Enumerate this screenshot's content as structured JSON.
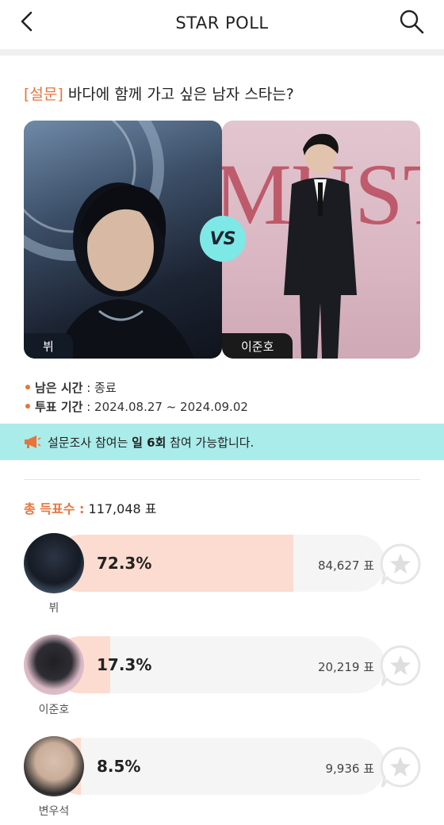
{
  "header": {
    "title": "STAR POLL"
  },
  "poll": {
    "tag": "[설문]",
    "question": "바다에 함께 가고 싶은 남자 스타는?",
    "left_name": "뷔",
    "right_name": "이준호",
    "vs_label": "VS",
    "remaining_label": "남은 시간",
    "remaining_value": ": 종료",
    "period_label": "투표 기간",
    "period_value": ": 2024.08.27 ~ 2024.09.02"
  },
  "notice": {
    "prefix": "설문조사 참여는 ",
    "highlight": "일 6회",
    "suffix": " 참여 가능합니다."
  },
  "total": {
    "label": "총 득표수 :",
    "value": " 117,048 표"
  },
  "results": [
    {
      "name": "뷔",
      "percent_text": "72.3%",
      "percent": 72.3,
      "votes": "84,627 표"
    },
    {
      "name": "이준호",
      "percent_text": "17.3%",
      "percent": 17.3,
      "votes": "20,219 표"
    },
    {
      "name": "변우석",
      "percent_text": "8.5%",
      "percent": 8.5,
      "votes": "9,936 표"
    }
  ],
  "colors": {
    "accent": "#e8743b",
    "notice_bg": "#a9ecea",
    "bar_fill": "#fcdcd0",
    "bar_track": "#f5f5f5",
    "vs_badge": "#7ee8e6"
  },
  "icons": {
    "back": "chevron-left-icon",
    "search": "search-icon",
    "notice": "megaphone-icon",
    "vote": "star-bubble-icon"
  }
}
